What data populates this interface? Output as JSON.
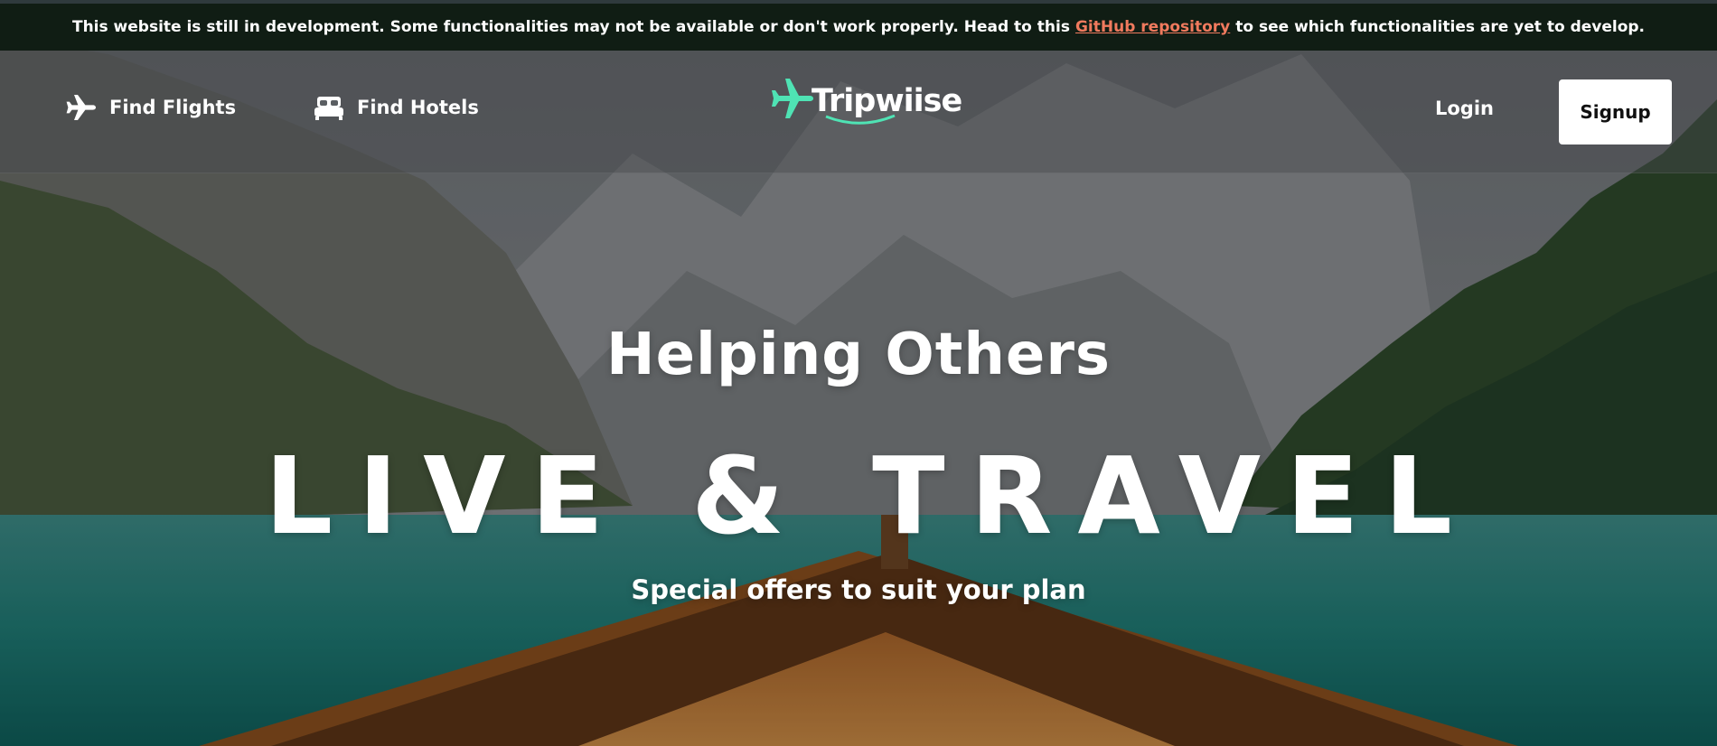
{
  "dev_banner": {
    "text_before": "This website is still in development. Some functionalities may not be available or don't work properly. Head to this",
    "link_text": "GitHub repository",
    "text_after": "to see which functionalities are yet to develop.",
    "link_color": "#f07a5e"
  },
  "navbar": {
    "find_flights": {
      "label": "Find Flights",
      "icon": "airplane-icon"
    },
    "find_hotels": {
      "label": "Find Hotels",
      "icon": "bed-icon"
    },
    "logo": {
      "text": "Tripwiise",
      "brand_color": "#4fe3b4"
    },
    "login_label": "Login",
    "signup_label": "Signup"
  },
  "hero": {
    "subtitle": "Helping Others",
    "title": "LIVE & TRAVEL",
    "tagline": "Special offers to suit your plan"
  }
}
